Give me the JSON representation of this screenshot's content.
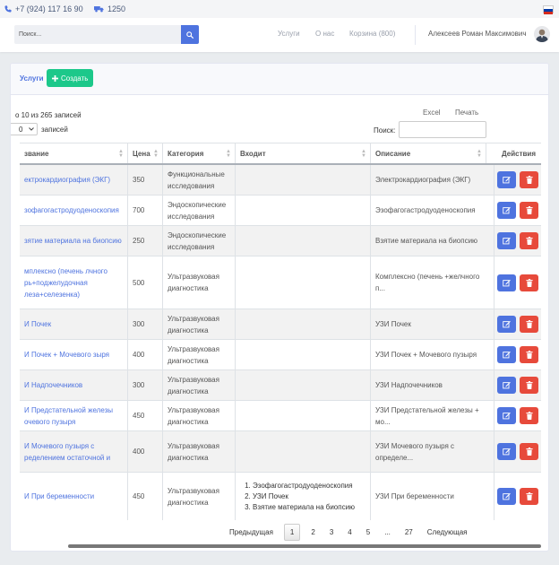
{
  "topbar": {
    "phone": "+7 (924) 117 16 90",
    "delivery": "1250",
    "phone_icon": "phone-icon",
    "truck_icon": "truck-icon",
    "flag_colors": [
      "#ffffff",
      "#0039a6",
      "#d52b1e"
    ]
  },
  "navbar": {
    "search_placeholder": "Поиск...",
    "links": [
      "Услуги",
      "О нас",
      "Корзина (800)"
    ],
    "user_name": "Алексеев Роман Максимович"
  },
  "card": {
    "title": "Услуги",
    "create_label": "Создать",
    "info": "о 10 из 265 записей",
    "length_value": "0",
    "length_suffix": "записей",
    "excel": "Excel",
    "print": "Печать",
    "search_label": "Поиск:"
  },
  "table": {
    "headers": [
      "звание",
      "Цена",
      "Категория",
      "Входит",
      "Описание",
      "Действия"
    ],
    "rows": [
      {
        "name": "ектрокардиография (ЭКГ)",
        "price": "350",
        "category": "Функциональные исследования",
        "includes": [],
        "description": "Электрокардиография (ЭКГ)"
      },
      {
        "name": "зофагогастродуоденоскопия",
        "price": "700",
        "category": "Эндоскопические исследования",
        "includes": [],
        "description": "Эзофагогастродуоденоскопия"
      },
      {
        "name": "зятие материала на биопсию",
        "price": "250",
        "category": "Эндоскопические исследования",
        "includes": [],
        "description": "Взятие материала на биопсию"
      },
      {
        "name": "мплексно (печень лчного рь+поджелудочная леза+селезенка)",
        "price": "500",
        "category": "Ультразвуковая диагностика",
        "includes": [],
        "description": "Комплексно (печень +желчного п..."
      },
      {
        "name": "И Почек",
        "price": "300",
        "category": "Ультразвуковая диагностика",
        "includes": [],
        "description": "УЗИ Почек"
      },
      {
        "name": "И Почек + Мочевого зыря",
        "price": "400",
        "category": "Ультразвуковая диагностика",
        "includes": [],
        "description": "УЗИ Почек + Мочевого пузыря"
      },
      {
        "name": "И Надпочечников",
        "price": "300",
        "category": "Ультразвуковая диагностика",
        "includes": [],
        "description": "УЗИ Надпочечников"
      },
      {
        "name": "И Предстательной железы очевого пузыря",
        "price": "450",
        "category": "Ультразвуковая диагностика",
        "includes": [],
        "description": "УЗИ Предстательной железы + мо..."
      },
      {
        "name": "И Мочевого пузыря с ределением остаточной и",
        "price": "400",
        "category": "Ультразвуковая диагностика",
        "includes": [],
        "description": "УЗИ Мочевого пузыря с определе..."
      },
      {
        "name": "И При беременности",
        "price": "450",
        "category": "Ультразвуковая диагностика",
        "includes": [
          "Эзофагогастродуоденоскопия",
          "УЗИ Почек",
          "Взятие материала на биопсию"
        ],
        "description": "УЗИ При беременности"
      }
    ]
  },
  "pagination": {
    "prev": "Предыдущая",
    "pages": [
      "1",
      "2",
      "3",
      "4",
      "5",
      "...",
      "27"
    ],
    "active": "1",
    "next": "Следующая"
  },
  "colors": {
    "primary": "#4e73df",
    "success": "#1cc88a",
    "danger": "#e74a3b"
  }
}
